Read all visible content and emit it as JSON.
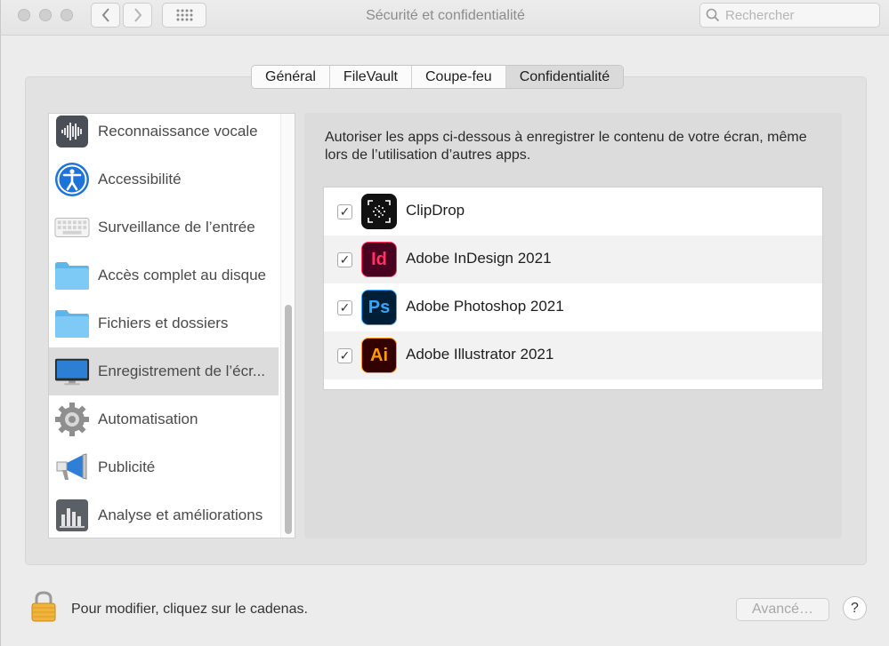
{
  "window": {
    "title": "Sécurité et confidentialité"
  },
  "toolbar": {
    "back_icon": "chevron-left-icon",
    "forward_icon": "chevron-right-icon",
    "grid_icon": "grid-icon"
  },
  "search": {
    "placeholder": "Rechercher"
  },
  "tabs": [
    {
      "label": "Général",
      "active": false
    },
    {
      "label": "FileVault",
      "active": false
    },
    {
      "label": "Coupe-feu",
      "active": false
    },
    {
      "label": "Confidentialité",
      "active": true
    }
  ],
  "sidebar": {
    "items": [
      {
        "label": "Reconnaissance vocale",
        "icon": "waveform-icon"
      },
      {
        "label": "Accessibilité",
        "icon": "accessibility-icon"
      },
      {
        "label": "Surveillance de l’entrée",
        "icon": "keyboard-icon"
      },
      {
        "label": "Accès complet au disque",
        "icon": "folder-icon"
      },
      {
        "label": "Fichiers et dossiers",
        "icon": "folder-icon"
      },
      {
        "label": "Enregistrement de l’écr...",
        "icon": "display-icon",
        "selected": true
      },
      {
        "label": "Automatisation",
        "icon": "gear-icon"
      },
      {
        "label": "Publicité",
        "icon": "megaphone-icon"
      },
      {
        "label": "Analyse et améliorations",
        "icon": "chart-icon"
      }
    ]
  },
  "content": {
    "description": "Autoriser les apps ci-dessous à enregistrer le contenu de votre écran, même lors de l’utilisation d’autres apps.",
    "apps": [
      {
        "label": "ClipDrop",
        "checked": true,
        "icon_text": "",
        "icon": "clipdrop-icon"
      },
      {
        "label": "Adobe InDesign 2021",
        "checked": true,
        "icon_text": "Id",
        "icon": "indesign-icon"
      },
      {
        "label": "Adobe Photoshop 2021",
        "checked": true,
        "icon_text": "Ps",
        "icon": "photoshop-icon"
      },
      {
        "label": "Adobe Illustrator 2021",
        "checked": true,
        "icon_text": "Ai",
        "icon": "illustrator-icon"
      }
    ]
  },
  "footer": {
    "lock_text": "Pour modifier, cliquez sur le cadenas.",
    "advanced_label": "Avancé…",
    "help_label": "?"
  },
  "colors": {
    "indesign_bg": "#49021f",
    "indesign_fg": "#ff3366",
    "photoshop_bg": "#001e36",
    "photoshop_fg": "#31a8ff",
    "illustrator_bg": "#330000",
    "illustrator_fg": "#ff9a00",
    "clipdrop_bg": "#111111"
  }
}
